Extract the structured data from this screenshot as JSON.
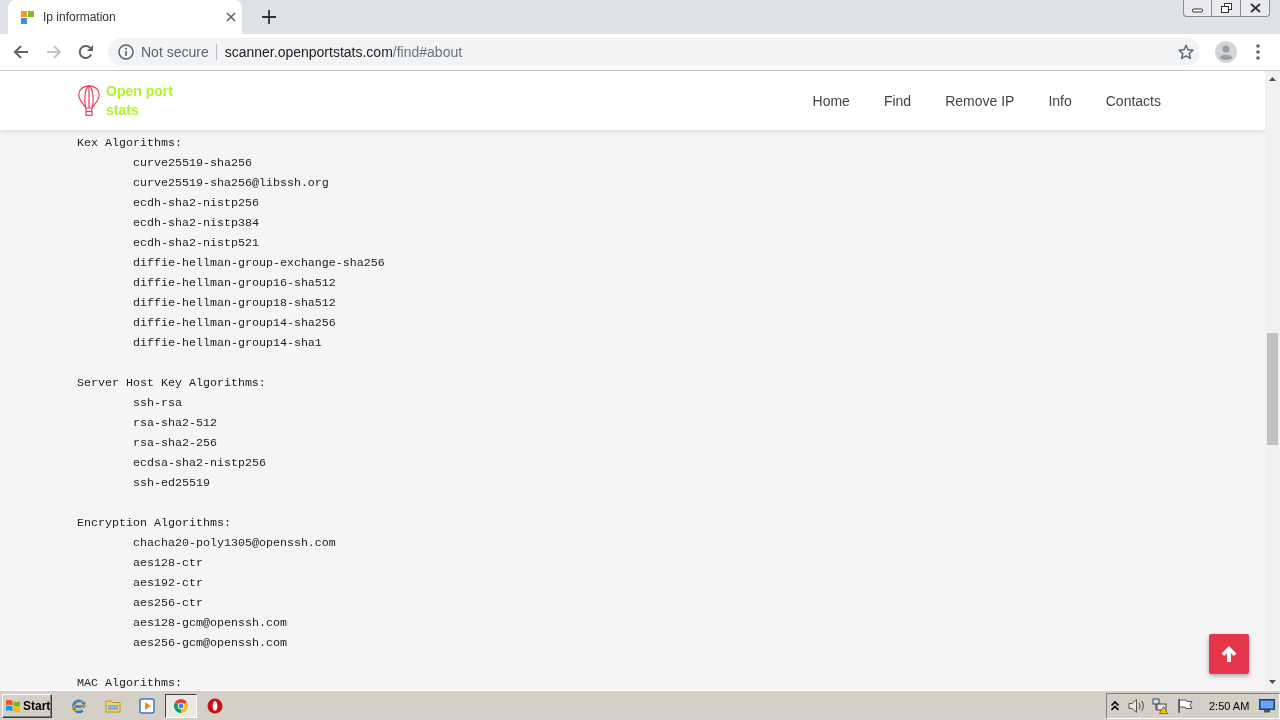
{
  "browser": {
    "tab": {
      "title": "Ip information"
    },
    "back": {
      "disabled": false
    },
    "forward": {
      "disabled": true
    },
    "address": {
      "security": "Not secure",
      "host": "scanner.openportstats.com",
      "path": "/find#about"
    }
  },
  "site_header": {
    "logo": "Open port stats",
    "nav": [
      {
        "label": "Home"
      },
      {
        "label": "Find"
      },
      {
        "label": "Remove IP"
      },
      {
        "label": "Info"
      },
      {
        "label": "Contacts"
      }
    ]
  },
  "content": {
    "sections": [
      {
        "heading": "Kex Algorithms:",
        "items": [
          "curve25519-sha256",
          "curve25519-sha256@libssh.org",
          "ecdh-sha2-nistp256",
          "ecdh-sha2-nistp384",
          "ecdh-sha2-nistp521",
          "diffie-hellman-group-exchange-sha256",
          "diffie-hellman-group16-sha512",
          "diffie-hellman-group18-sha512",
          "diffie-hellman-group14-sha256",
          "diffie-hellman-group14-sha1"
        ]
      },
      {
        "heading": "Server Host Key Algorithms:",
        "items": [
          "ssh-rsa",
          "rsa-sha2-512",
          "rsa-sha2-256",
          "ecdsa-sha2-nistp256",
          "ssh-ed25519"
        ]
      },
      {
        "heading": "Encryption Algorithms:",
        "items": [
          "chacha20-poly1305@openssh.com",
          "aes128-ctr",
          "aes192-ctr",
          "aes256-ctr",
          "aes128-gcm@openssh.com",
          "aes256-gcm@openssh.com"
        ]
      },
      {
        "heading": "MAC Algorithms:"
      }
    ]
  },
  "taskbar": {
    "start": "Start",
    "apps": [
      {
        "kind": "globe",
        "selected": false
      },
      {
        "kind": "folder",
        "selected": false
      },
      {
        "kind": "player",
        "selected": false
      },
      {
        "kind": "wheel",
        "selected": true
      },
      {
        "kind": "ring",
        "selected": false
      }
    ],
    "clock": "2:50 AM"
  }
}
